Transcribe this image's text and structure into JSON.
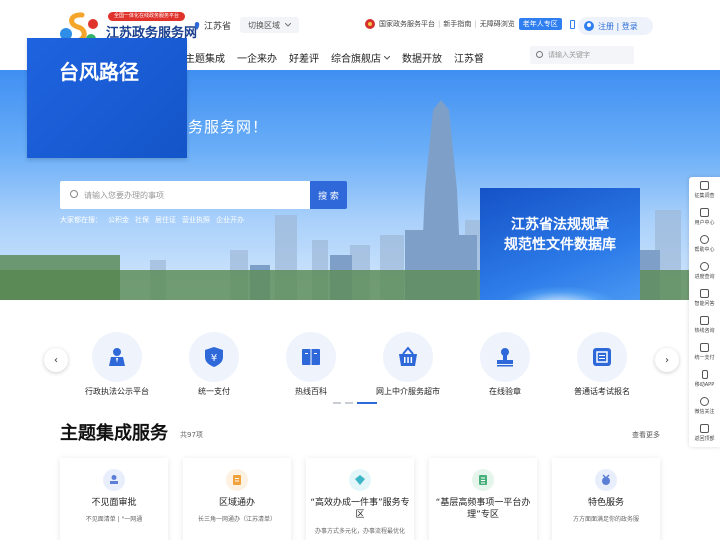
{
  "header": {
    "logo_text": "江苏政务服务网",
    "logo_badge": "全国一体化在线政务服务平台",
    "location": "江苏省",
    "switch_area": "切换区域",
    "top_links": [
      "国家政务服务平台",
      "新手指南",
      "无障碍浏览"
    ],
    "elder_mode": "老年人专区",
    "login": "注册 | 登录"
  },
  "nav": {
    "items": [
      "主题集成",
      "一企来办",
      "好差评",
      "综合旗舰店",
      "数据开放",
      "江苏督"
    ],
    "search_placeholder": "请输入关键字"
  },
  "banner": {
    "slogan": "务服务网！",
    "typhoon": "台风路径",
    "search_placeholder": "请输入您要办理的事项",
    "search_button": "搜 索",
    "hot_words": [
      "大家都在搜：",
      "公积金",
      "社保",
      "居住证",
      "营业执照",
      "企业开办"
    ],
    "law_db_line1": "江苏省法规规章",
    "law_db_line2": "规范性文件数据库"
  },
  "float_bar": [
    "征集调查",
    "用户中心",
    "帮助中心",
    "进度查询",
    "智能问答",
    "热线咨询",
    "统一支付",
    "移动APP",
    "微信关注",
    "返回顶部"
  ],
  "services": [
    {
      "label": "行政执法公示平台",
      "icon": "person-badge-icon"
    },
    {
      "label": "统一支付",
      "icon": "yuan-shield-icon"
    },
    {
      "label": "热线百科",
      "icon": "book-icon"
    },
    {
      "label": "网上中介服务超市",
      "icon": "basket-icon"
    },
    {
      "label": "在线验章",
      "icon": "seal-icon"
    },
    {
      "label": "普通话考试报名",
      "icon": "certificate-icon"
    }
  ],
  "theme": {
    "title": "主题集成服务",
    "count": "共97项",
    "more": "查看更多",
    "cards": [
      {
        "title": "不见面审批",
        "desc": "不见面清单 | \"一网通",
        "accent": "#5b7fd6"
      },
      {
        "title": "区域通办",
        "desc": "长三角一网通办（江苏清单）",
        "accent": "#f0a13c"
      },
      {
        "title": "“高效办成一件事”服务专区",
        "desc": "办事方式多元化，办事流程最优化",
        "accent": "#3fb6c8"
      },
      {
        "title": "“基层高频事项一平台办理”专区",
        "desc": "",
        "accent": "#47b07a"
      },
      {
        "title": "特色服务",
        "desc": "方方面面满足你的政务服",
        "accent": "#5b7fd6"
      }
    ]
  },
  "colors": {
    "brand_blue": "#2f68d8",
    "accent_red": "#e0332b"
  }
}
